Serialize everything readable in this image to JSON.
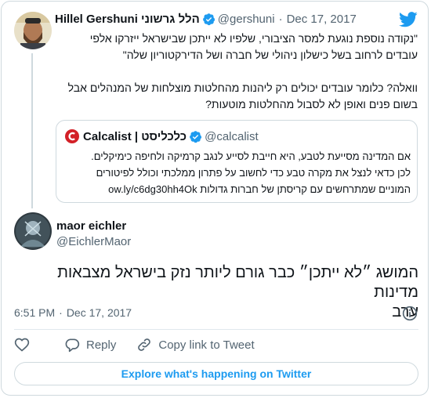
{
  "parent_tweet": {
    "name": "Hillel Gershuni הלל גרשוני",
    "handle": "@gershuni",
    "separator": "·",
    "date": "Dec 17, 2017",
    "text_line1": "\"נקודה נוספת נוגעת למסר הציבורי, שלפיו לא ייתכן שבישראל ייזרקו אלפי",
    "text_line2": "עובדים לרחוב בשל כישלון ניהולי של חברה ושל הדירקטוריון שלה\"",
    "text_line3": "וואלה? כלומר עובדים יכולים רק ליהנות מהחלטות מוצלחות של המנהלים אבל",
    "text_line4": "בשום פנים ואופן לא לסבול מהחלטות מוטעות?"
  },
  "quoted_tweet": {
    "name": "Calcalist | כלכליסט",
    "handle": "@calcalist",
    "text_line1": "אם המדינה מסייעת לטבע, היא חייבת לסייע לנגב קרמיקה ולחיפה כימיקלים.",
    "text_line2": "לכן כדאי לנצל את מקרה טבע כדי לחשוב על פתרון ממלכתי וכולל לפיטורים",
    "text_line3": "המוניים שמתרחשים עם קריסתן של חברות גדולות",
    "link": "ow.ly/c6dg30hh4Ok"
  },
  "main_tweet": {
    "name": "maor eichler",
    "handle": "@EichlerMaor",
    "text_line1": "המושג ״לא ייתכן״ כבר גורם ליותר נזק בישראל מצבאות מדינות",
    "text_line2": "ערב",
    "time": "6:51 PM",
    "separator": "·",
    "date": "Dec 17, 2017"
  },
  "actions": {
    "reply_label": "Reply",
    "copy_link_label": "Copy link to Tweet"
  },
  "explore_label": "Explore what's happening on Twitter",
  "icons": [
    "twitter-bird-icon",
    "verified-badge-icon",
    "info-icon",
    "heart-icon",
    "reply-icon",
    "link-icon"
  ],
  "colors": {
    "accent": "#1d9bf0",
    "secondary_text": "#536471",
    "border": "#cfd9de",
    "calcalist_red": "#d32027"
  }
}
